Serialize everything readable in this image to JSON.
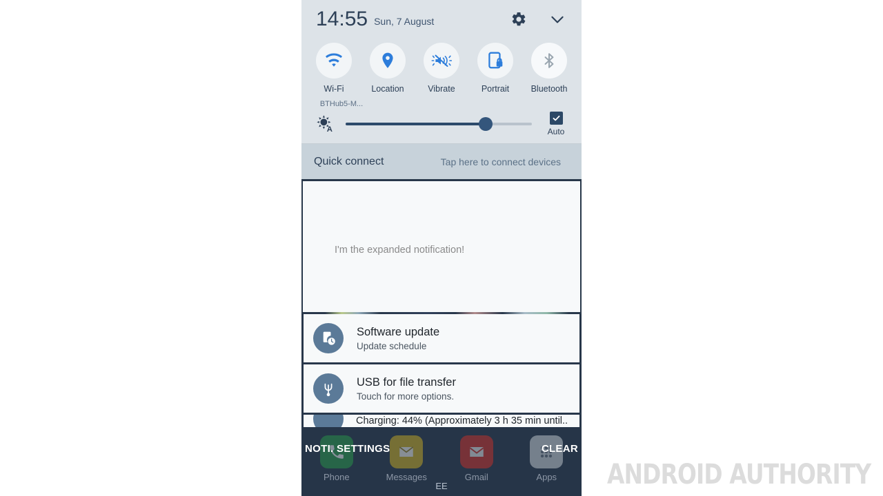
{
  "status_header": {
    "time": "14:55",
    "date": "Sun, 7 August",
    "settings_icon": "gear-icon",
    "collapse_icon": "chevron-down-icon"
  },
  "quick_settings": {
    "toggles": [
      {
        "label": "Wi-Fi",
        "icon": "wifi-icon",
        "sub": "BTHub5-M...",
        "active": true
      },
      {
        "label": "Location",
        "icon": "location-pin-icon",
        "sub": "",
        "active": true
      },
      {
        "label": "Vibrate",
        "icon": "vibrate-icon",
        "sub": "",
        "active": true
      },
      {
        "label": "Portrait",
        "icon": "screen-rotation-lock-icon",
        "sub": "",
        "active": true
      },
      {
        "label": "Bluetooth",
        "icon": "bluetooth-icon",
        "sub": "",
        "active": false
      }
    ],
    "brightness": {
      "icon": "auto-brightness-icon",
      "value_percent": 75,
      "auto_label": "Auto",
      "auto_checked": true,
      "checkbox_icon": "checkbox-checked-icon"
    }
  },
  "quick_connect": {
    "title": "Quick connect",
    "hint": "Tap here to connect devices"
  },
  "notifications": {
    "expanded": {
      "body": "I'm the expanded notification!"
    },
    "items": [
      {
        "icon": "software-update-icon",
        "title": "Software update",
        "subtitle": "Update schedule"
      },
      {
        "icon": "usb-icon",
        "title": "USB for file transfer",
        "subtitle": "Touch for more options."
      }
    ],
    "partial": {
      "icon": "battery-charging-icon",
      "text": "Charging: 44% (Approximately 3 h 35 min until.."
    }
  },
  "bottom_actions": {
    "noti_settings": "NOTI. SETTINGS",
    "clear": "CLEAR"
  },
  "home_screen": {
    "dock": [
      {
        "label": "Phone",
        "icon": "phone-icon"
      },
      {
        "label": "Messages",
        "icon": "messages-icon"
      },
      {
        "label": "Gmail",
        "icon": "gmail-icon"
      },
      {
        "label": "Apps",
        "icon": "apps-grid-icon"
      }
    ],
    "carrier": "EE"
  },
  "watermark": {
    "text": "ANDROID AUTHORITY"
  },
  "colors": {
    "accent_blue": "#2d7ddb",
    "panel_bg": "#dde3e8",
    "quick_connect_bg": "#c7d2da",
    "notif_border": "#28374a",
    "home_bg": "#263548",
    "inactive_gray": "#9aa6b0"
  }
}
